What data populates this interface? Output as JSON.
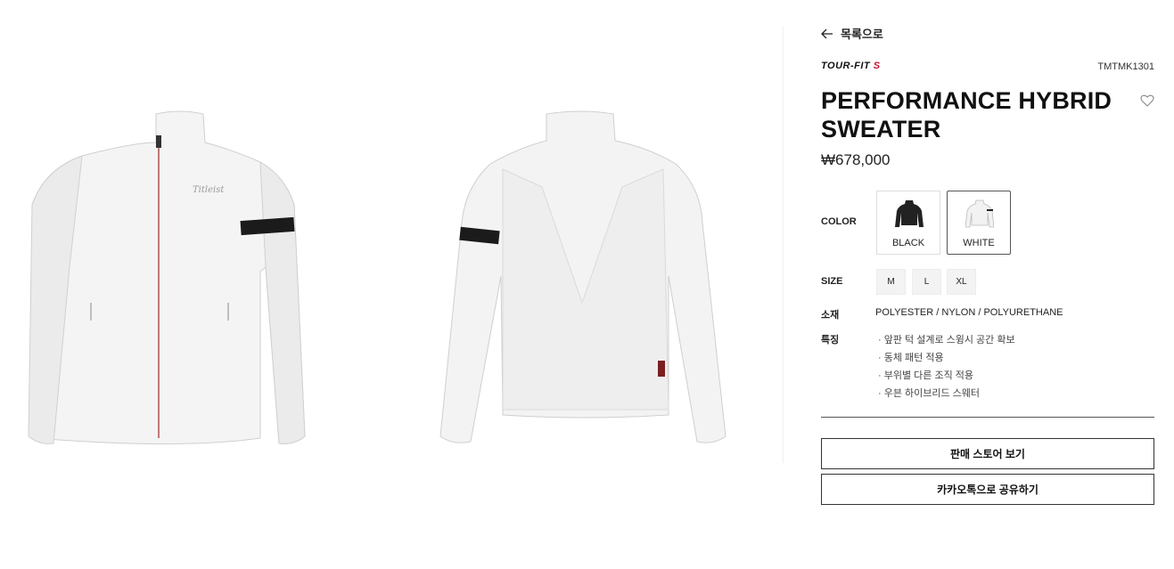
{
  "nav": {
    "back_label": "목록으로"
  },
  "product": {
    "brand": {
      "text": "TOUR-FIT",
      "accent": "S"
    },
    "model_code": "TMTMK1301",
    "title": "PERFORMANCE HYBRID SWEATER",
    "price": "₩678,000"
  },
  "options": {
    "color_label": "COLOR",
    "colors": [
      {
        "name": "BLACK",
        "selected": false
      },
      {
        "name": "WHITE",
        "selected": true
      }
    ],
    "size_label": "SIZE",
    "sizes": [
      "M",
      "L",
      "XL"
    ]
  },
  "details": {
    "material_label": "소재",
    "material_value": "POLYESTER / NYLON / POLYURETHANE",
    "features_label": "특징",
    "features": [
      "앞판 턱 설계로 스윙시 공간 확보",
      "동체 패턴 적용",
      "부위별 다른 조직 적용",
      "우븐 하이브리드 스웨터"
    ]
  },
  "actions": {
    "store_button": "판매 스토어 보기",
    "share_button": "카카오톡으로 공유하기"
  },
  "colors": {
    "brand_accent": "#c8102e",
    "text": "#111111",
    "border_selected": "#555555"
  },
  "icons": [
    "arrow-left-icon",
    "heart-icon"
  ]
}
